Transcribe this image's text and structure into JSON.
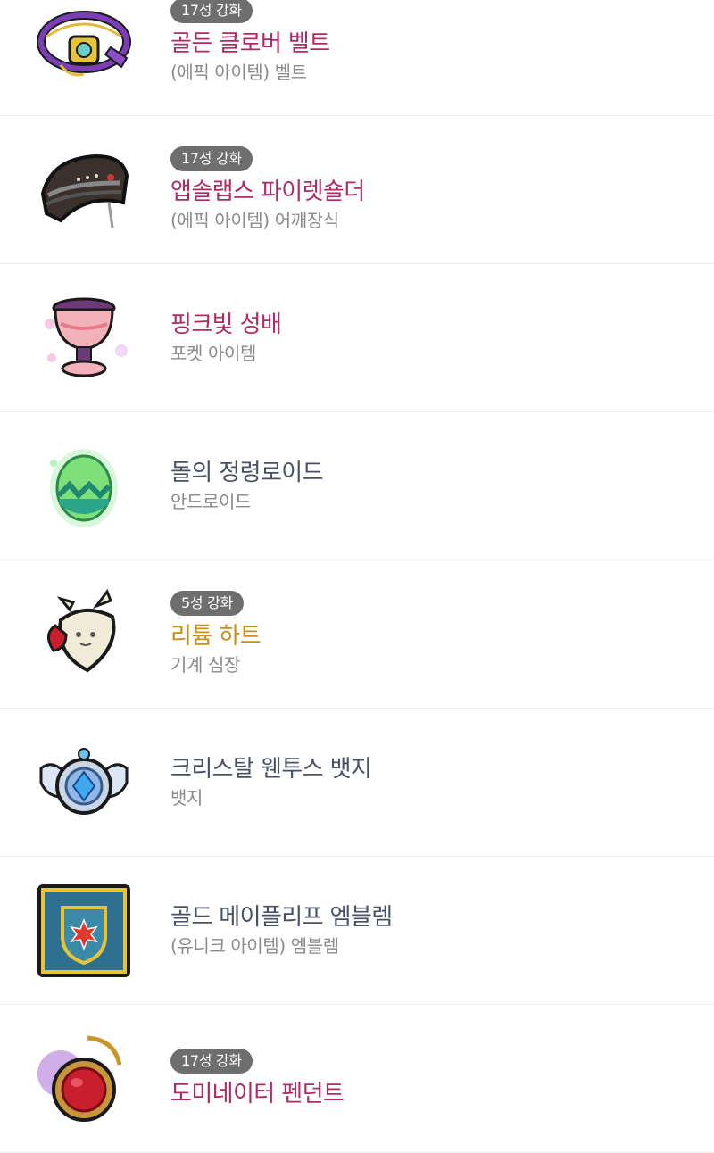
{
  "items": [
    {
      "badge": "17성 강화",
      "name": "골든 클로버 벨트",
      "sub": "(에픽 아이템) 벨트",
      "name_color": "#b02a66",
      "icon": "golden-clover-belt-icon"
    },
    {
      "badge": "17성 강화",
      "name": "앱솔랩스 파이렛숄더",
      "sub": "(에픽 아이템) 어깨장식",
      "name_color": "#b02a66",
      "icon": "absolab-pirate-shoulder-icon"
    },
    {
      "badge": "",
      "name": "핑크빛 성배",
      "sub": "포켓 아이템",
      "name_color": "#b02a66",
      "icon": "pink-holy-cup-icon"
    },
    {
      "badge": "",
      "name": "돌의 정령로이드",
      "sub": "안드로이드",
      "name_color": "#4a5064",
      "icon": "stone-spirit-android-icon"
    },
    {
      "badge": "5성 강화",
      "name": "리튬 하트",
      "sub": "기계 심장",
      "name_color": "#c99020",
      "icon": "lithium-heart-icon"
    },
    {
      "badge": "",
      "name": "크리스탈 웬투스 뱃지",
      "sub": "뱃지",
      "name_color": "#4a5064",
      "icon": "crystal-ventus-badge-icon"
    },
    {
      "badge": "",
      "name": "골드 메이플리프 엠블렘",
      "sub": "(유니크 아이템) 엠블렘",
      "name_color": "#4a5064",
      "icon": "gold-maple-leaf-emblem-icon"
    },
    {
      "badge": "17성 강화",
      "name": "도미네이터 펜던트",
      "sub": "",
      "name_color": "#b02a66",
      "icon": "dominator-pendant-icon"
    }
  ]
}
